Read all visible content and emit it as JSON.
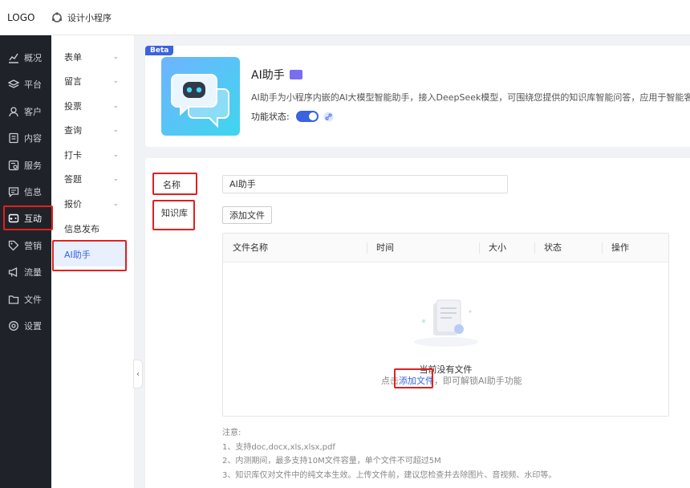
{
  "topbar": {
    "logo": "LOGO",
    "app_name": "设计小程序"
  },
  "sidebar": {
    "items": [
      {
        "label": "概况",
        "icon": "chart-line-icon"
      },
      {
        "label": "平台",
        "icon": "layers-icon"
      },
      {
        "label": "客户",
        "icon": "user-icon"
      },
      {
        "label": "内容",
        "icon": "document-icon"
      },
      {
        "label": "服务",
        "icon": "service-icon"
      },
      {
        "label": "信息",
        "icon": "message-icon"
      },
      {
        "label": "互动",
        "icon": "gamepad-icon",
        "active": true
      },
      {
        "label": "营销",
        "icon": "tag-icon"
      },
      {
        "label": "流量",
        "icon": "megaphone-icon"
      },
      {
        "label": "文件",
        "icon": "folder-icon"
      },
      {
        "label": "设置",
        "icon": "gear-icon"
      }
    ]
  },
  "submenu": {
    "items": [
      {
        "label": "表单",
        "chevron": "⌄"
      },
      {
        "label": "留言",
        "chevron": "⌄"
      },
      {
        "label": "投票",
        "chevron": "⌄"
      },
      {
        "label": "查询",
        "chevron": "⌄"
      },
      {
        "label": "打卡",
        "chevron": "⌄"
      },
      {
        "label": "答题",
        "chevron": "⌄"
      },
      {
        "label": "报价",
        "chevron": "⌄"
      },
      {
        "label": "信息发布",
        "chevron": ""
      },
      {
        "label": "AI助手",
        "chevron": "",
        "active": true
      }
    ],
    "collapse": "‹"
  },
  "assistant": {
    "badge": "Beta",
    "title": "AI助手",
    "description": "AI助手为小程序内嵌的AI大模型智能助手，接入DeepSeek模型，可围绕您提供的知识库智能问答，应用于智能客服、行业顾问等",
    "status_label": "功能状态:",
    "enabled": true
  },
  "form": {
    "name_label": "名称",
    "name_value": "AI助手",
    "kb_label": "知识库",
    "add_file_button": "添加文件"
  },
  "table": {
    "columns": [
      "文件名称",
      "时间",
      "大小",
      "状态",
      "操作"
    ],
    "empty_title": "当前没有文件",
    "empty_hint_prefix": "点击",
    "empty_hint_link": "添加文件",
    "empty_hint_suffix": "，即可解锁AI助手功能"
  },
  "notes": {
    "title": "注意:",
    "lines": [
      "1、支持doc,docx,xls,xlsx,pdf",
      "2、内测期间，最多支持10M文件容量，单个文件不可超过5M",
      "3、知识库仅对文件中的纯文本生效。上传文件前，建议您检查并去除图片、音视频、水印等。"
    ]
  },
  "colors": {
    "accent": "#3a63e0",
    "highlight": "#e02020",
    "sidebar": "#1f2329"
  }
}
